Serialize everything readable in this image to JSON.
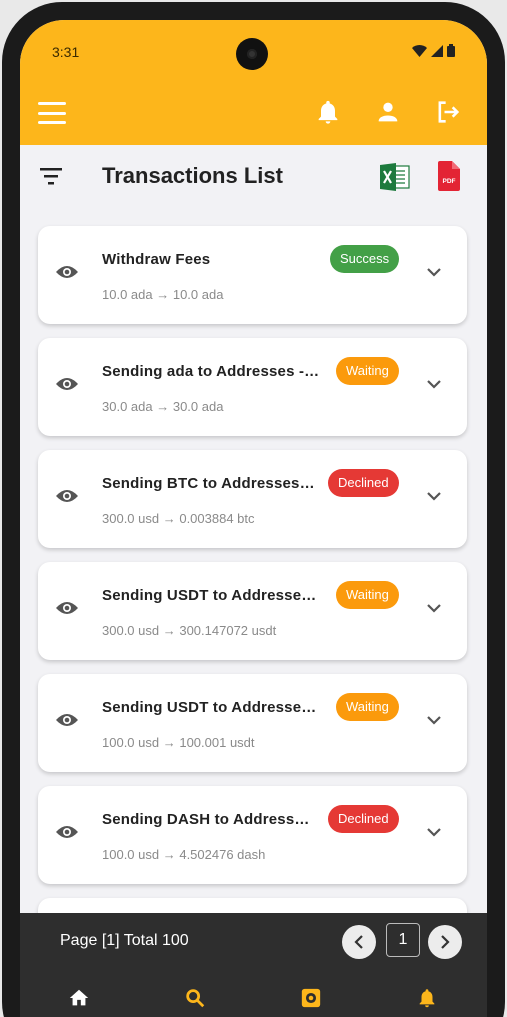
{
  "status_bar": {
    "time": "3:31"
  },
  "header": {
    "title": "Transactions List"
  },
  "colors": {
    "accent": "#fdb61b",
    "success": "#43a047",
    "waiting": "#fb9a0c",
    "declined": "#e53935",
    "footer": "#2e2e2e"
  },
  "transactions": [
    {
      "title": "Withdraw Fees",
      "from": "10.0 ada",
      "to": "10.0 ada",
      "status": "Success"
    },
    {
      "title": "Sending ada to Addresses -…",
      "from": "30.0 ada",
      "to": "30.0 ada",
      "status": "Waiting"
    },
    {
      "title": "Sending BTC to Addresses…",
      "from": "300.0 usd",
      "to": "0.003884 btc",
      "status": "Declined"
    },
    {
      "title": "Sending USDT to Addresse…",
      "from": "300.0 usd",
      "to": "300.147072 usdt",
      "status": "Waiting"
    },
    {
      "title": "Sending USDT to Addresse…",
      "from": "100.0 usd",
      "to": "100.001 usdt",
      "status": "Waiting"
    },
    {
      "title": "Sending DASH to Address…",
      "from": "100.0 usd",
      "to": "4.502476 dash",
      "status": "Declined"
    }
  ],
  "pagination": {
    "info": "Page [1] Total 100",
    "current_page": "1"
  },
  "bottom_nav": [
    "home-icon",
    "search-icon",
    "settings-icon",
    "notifications-icon"
  ]
}
